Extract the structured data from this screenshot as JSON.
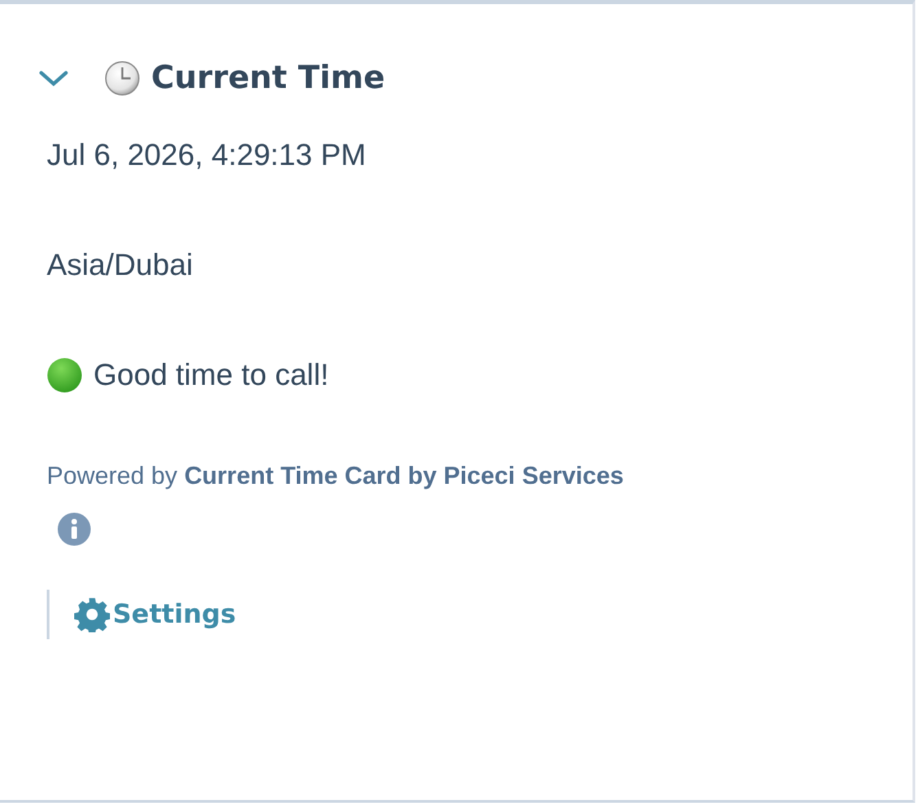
{
  "card": {
    "title": "Current Time",
    "expanded": true,
    "datetime": "Jul 6, 2026, 4:29:13 PM",
    "timezone": "Asia/Dubai",
    "status": {
      "kind": "good",
      "text": "Good time to call!"
    },
    "powered_by": "Powered by **Current Time Card by Piceci Services**",
    "settings_link": "Settings"
  }
}
